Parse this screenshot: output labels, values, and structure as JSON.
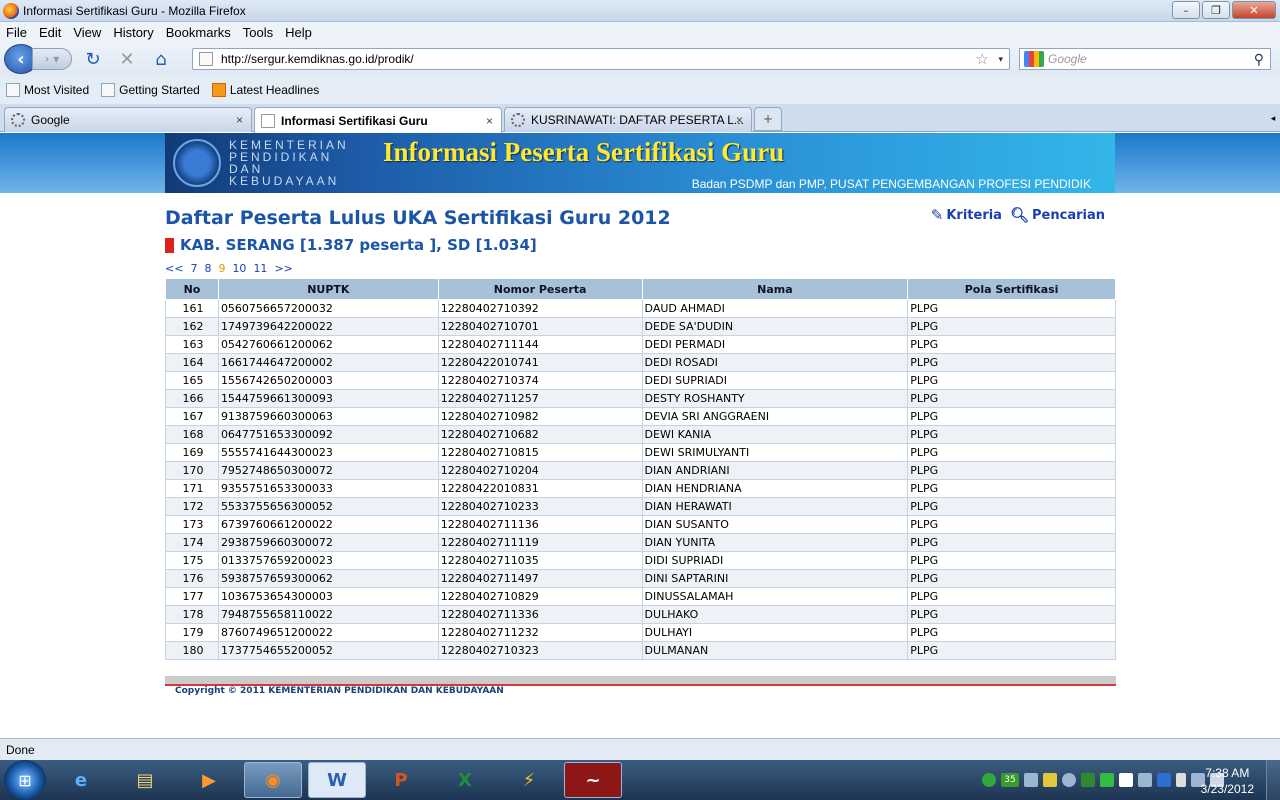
{
  "window": {
    "title": "Informasi Sertifikasi Guru - Mozilla Firefox"
  },
  "menu": [
    "File",
    "Edit",
    "View",
    "History",
    "Bookmarks",
    "Tools",
    "Help"
  ],
  "nav": {
    "url": "http://sergur.kemdiknas.go.id/prodik/",
    "search_placeholder": "Google"
  },
  "bookmarks": [
    "Most Visited",
    "Getting Started",
    "Latest Headlines"
  ],
  "tabs": [
    {
      "label": "Google",
      "close": "×"
    },
    {
      "label": "Informasi Sertifikasi Guru",
      "close": "×"
    },
    {
      "label": "KUSRINAWATI: DAFTAR PESERTA L...",
      "close": "×"
    }
  ],
  "banner": {
    "ministry": "KEMENTERIAN\nPENDIDIKAN\nDAN\nKEBUDAYAAN",
    "heading": "Informasi Peserta Sertifikasi Guru",
    "sub": "Badan PSDMP dan PMP, PUSAT PENGEMBANGAN PROFESI PENDIDIK"
  },
  "page": {
    "title": "Daftar Peserta Lulus UKA Sertifikasi Guru 2012",
    "subtitle": "KAB. SERANG [1.387 peserta ], SD [1.034]",
    "link_kriteria": "Kriteria",
    "link_pencarian": "Pencarian",
    "pager": [
      "<<",
      "7",
      "8",
      "9",
      "10",
      "11",
      ">>"
    ],
    "current_page": "9",
    "copyright": "Copyright © 2011 KEMENTERIAN PENDIDIKAN DAN KEBUDAYAAN"
  },
  "table": {
    "headers": [
      "No",
      "NUPTK",
      "Nomor Peserta",
      "Nama",
      "Pola Sertifikasi"
    ],
    "rows": [
      [
        "161",
        "0560756657200032",
        "12280402710392",
        "DAUD AHMADI",
        "PLPG"
      ],
      [
        "162",
        "1749739642200022",
        "12280402710701",
        "DEDE SA'DUDIN",
        "PLPG"
      ],
      [
        "163",
        "0542760661200062",
        "12280402711144",
        "DEDI PERMADI",
        "PLPG"
      ],
      [
        "164",
        "1661744647200002",
        "12280422010741",
        "DEDI ROSADI",
        "PLPG"
      ],
      [
        "165",
        "1556742650200003",
        "12280402710374",
        "DEDI SUPRIADI",
        "PLPG"
      ],
      [
        "166",
        "1544759661300093",
        "12280402711257",
        "DESTY ROSHANTY",
        "PLPG"
      ],
      [
        "167",
        "9138759660300063",
        "12280402710982",
        "DEVIA SRI ANGGRAENI",
        "PLPG"
      ],
      [
        "168",
        "0647751653300092",
        "12280402710682",
        "DEWI KANIA",
        "PLPG"
      ],
      [
        "169",
        "5555741644300023",
        "12280402710815",
        "DEWI SRIMULYANTI",
        "PLPG"
      ],
      [
        "170",
        "7952748650300072",
        "12280402710204",
        "DIAN ANDRIANI",
        "PLPG"
      ],
      [
        "171",
        "9355751653300033",
        "12280422010831",
        "DIAN HENDRIANA",
        "PLPG"
      ],
      [
        "172",
        "5533755656300052",
        "12280402710233",
        "DIAN HERAWATI",
        "PLPG"
      ],
      [
        "173",
        "6739760661200022",
        "12280402711136",
        "DIAN SUSANTO",
        "PLPG"
      ],
      [
        "174",
        "2938759660300072",
        "12280402711119",
        "DIAN YUNITA",
        "PLPG"
      ],
      [
        "175",
        "0133757659200023",
        "12280402711035",
        "DIDI SUPRIADI",
        "PLPG"
      ],
      [
        "176",
        "5938757659300062",
        "12280402711497",
        "DINI SAPTARINI",
        "PLPG"
      ],
      [
        "177",
        "1036753654300003",
        "12280402710829",
        "DINUSSALAMAH",
        "PLPG"
      ],
      [
        "178",
        "7948755658110022",
        "12280402711336",
        "DULHAKO",
        "PLPG"
      ],
      [
        "179",
        "8760749651200022",
        "12280402711232",
        "DULHAYI",
        "PLPG"
      ],
      [
        "180",
        "1737754655200052",
        "12280402710323",
        "DULMANAN",
        "PLPG"
      ]
    ]
  },
  "status": "Done",
  "taskbar": {
    "apps": [
      "ie-icon",
      "explorer-icon",
      "media-player-icon",
      "firefox-icon",
      "word-icon",
      "powerpoint-icon",
      "excel-icon",
      "winamp-icon",
      "app-icon"
    ],
    "tray_badge": "35",
    "time": "7:38 AM",
    "date": "3/23/2012"
  },
  "colors": {
    "title_blue": "#1c55a8",
    "banner_yellow": "#ffe830",
    "header_row": "#a7c2d8",
    "marker_red": "#d9231b"
  }
}
